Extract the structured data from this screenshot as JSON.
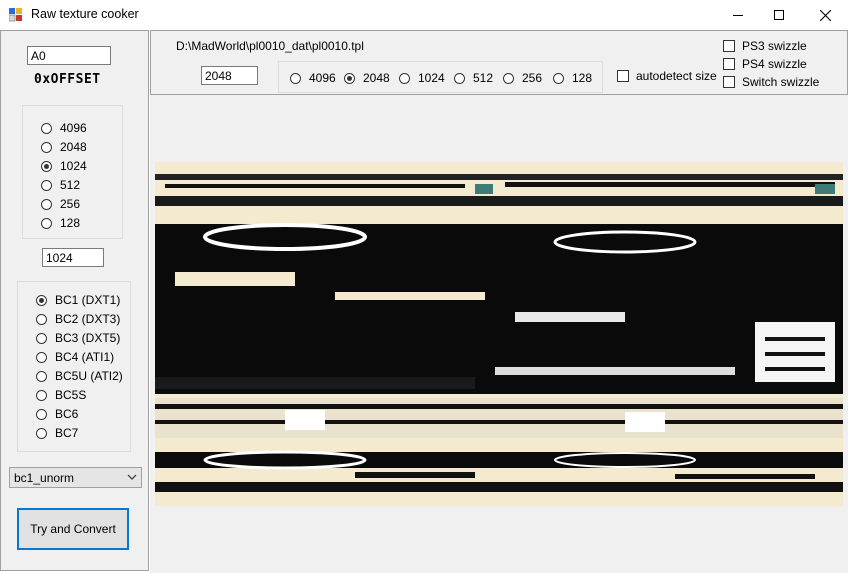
{
  "window": {
    "title": "Raw texture cooker",
    "icon": "app-icon",
    "controls": [
      "minimize-icon",
      "maximize-icon",
      "close-icon"
    ]
  },
  "left": {
    "offset_value": "A0",
    "offset_label": "0xOFFSET",
    "size_options": [
      "4096",
      "2048",
      "1024",
      "512",
      "256",
      "128"
    ],
    "size_selected": "1024",
    "size_value": "1024",
    "format_options": [
      "BC1 (DXT1)",
      "BC2 (DXT3)",
      "BC3 (DXT5)",
      "BC4 (ATI1)",
      "BC5U (ATI2)",
      "BC5S",
      "BC6",
      "BC7"
    ],
    "format_selected": "BC1 (DXT1)",
    "dxgi_format": "bc1_unorm",
    "convert_label": "Try and Convert"
  },
  "top": {
    "file_path": "D:\\MadWorld\\pl0010_dat\\pl0010.tpl",
    "width_value": "2048",
    "size_options": [
      "4096",
      "2048",
      "1024",
      "512",
      "256",
      "128"
    ],
    "size_selected": "2048",
    "autodetect_label": "autodetect size",
    "autodetect_checked": false,
    "swizzle_options": [
      {
        "label": "PS3 swizzle",
        "checked": false
      },
      {
        "label": "PS4 swizzle",
        "checked": false
      },
      {
        "label": "Switch swizzle",
        "checked": false
      }
    ]
  },
  "colors": {
    "accent": "#0078d7",
    "panel_bg": "#f0f0f0",
    "preview_cream": "#f3ead0"
  }
}
